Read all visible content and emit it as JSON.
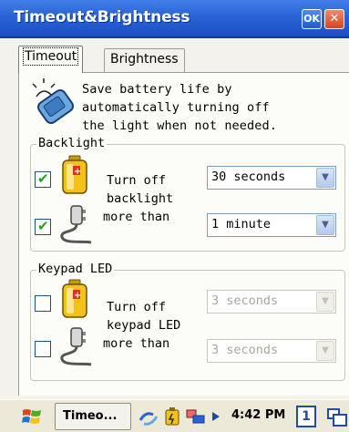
{
  "window": {
    "title": "Timeout&Brightness",
    "ok_label": "OK",
    "close_label": "✕"
  },
  "tabs": [
    {
      "label": "Timeout",
      "active": true
    },
    {
      "label": "Brightness",
      "active": false
    }
  ],
  "description": {
    "line1": "Save battery life by",
    "line2": "automatically turning off",
    "line3": "the light when not needed."
  },
  "backlight": {
    "group_label": "Backlight",
    "label_line1": "Turn off",
    "label_line2": "backlight",
    "label_line3": "more than",
    "battery_checked": true,
    "battery_value": "30 seconds",
    "external_checked": true,
    "external_value": "1 minute"
  },
  "keypad": {
    "group_label": "Keypad LED",
    "label_line1": "Turn off",
    "label_line2": "keypad LED",
    "label_line3": "more than",
    "battery_checked": false,
    "battery_value": "3 seconds",
    "external_checked": false,
    "external_value": "3 seconds"
  },
  "taskbar": {
    "task_label": "Timeo...",
    "clock": "4:42 PM",
    "badge": "1"
  },
  "colors": {
    "titlebar": "#2a63d6",
    "check": "#21a121",
    "background": "#fcfcf8"
  }
}
